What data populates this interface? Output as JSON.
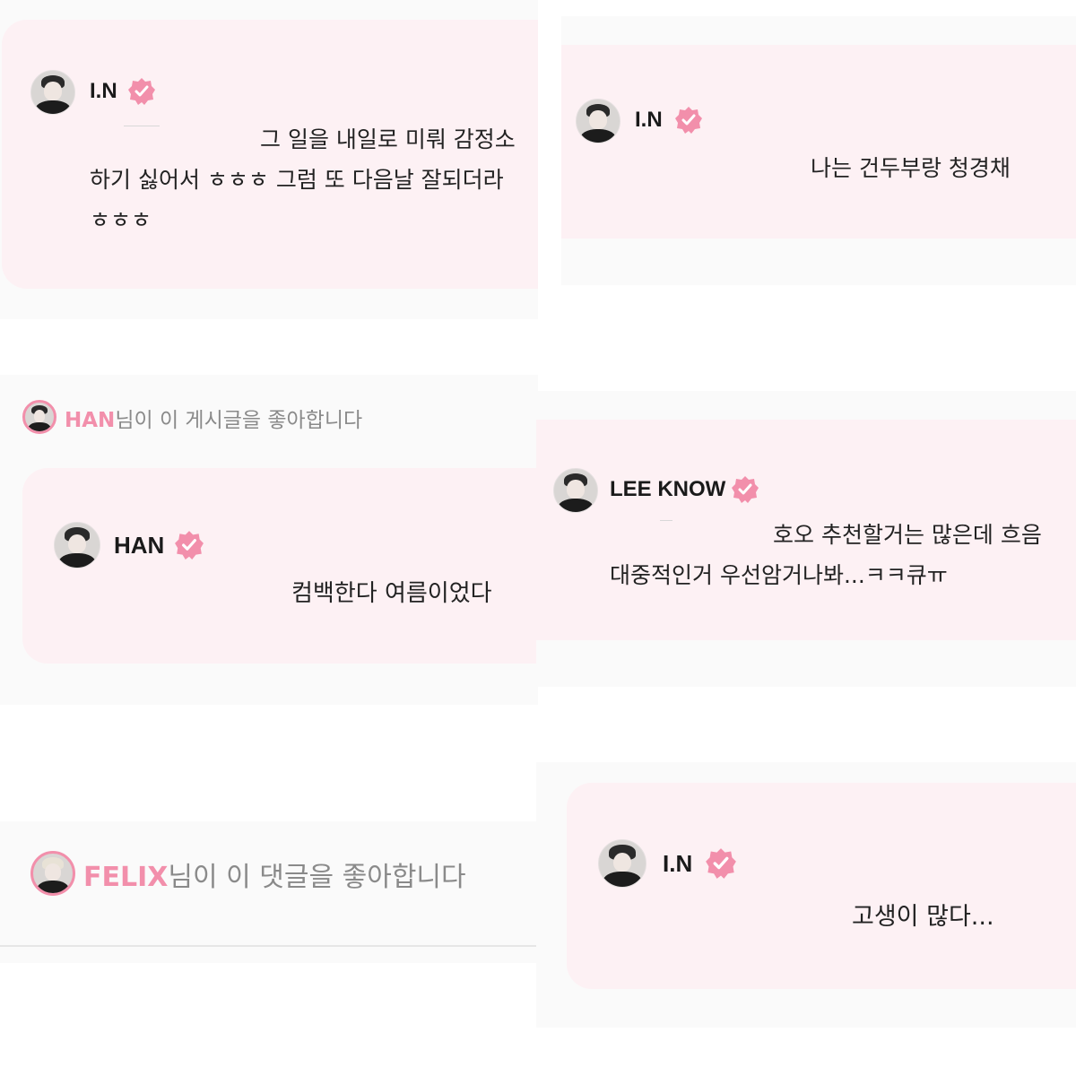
{
  "colors": {
    "accent": "#f28fab",
    "bubble": "#fdf1f4",
    "panel": "#fafafa"
  },
  "comments": [
    {
      "author": "I.N",
      "badge_icon": "verified-badge-icon",
      "lines": [
        "그 일을 내일로 미뤄 감정소",
        "하기 싫어서 ㅎㅎㅎ 그럼 또 다음날 잘되더라",
        "ㅎㅎㅎ"
      ]
    },
    {
      "author": "I.N",
      "badge_icon": "verified-badge-icon",
      "lines": [
        "나는 건두부랑 청경채"
      ]
    },
    {
      "author": "HAN",
      "badge_icon": "verified-badge-icon",
      "lines": [
        "컴백한다 여름이었다"
      ]
    },
    {
      "author": "LEE KNOW",
      "badge_icon": "verified-badge-icon",
      "lines": [
        "호오 추천할거는 많은데 흐음",
        "대중적인거 우선암거나봐...ㅋㅋ큐ㅠ"
      ]
    },
    {
      "author": "I.N",
      "badge_icon": "verified-badge-icon",
      "lines": [
        "고생이 많다..."
      ]
    }
  ],
  "likes": [
    {
      "who": "HAN",
      "suffix": "님이 이 게시글을 좋아합니다"
    },
    {
      "who": "FELIX",
      "suffix": "님이 이 댓글을 좋아합니다"
    }
  ]
}
